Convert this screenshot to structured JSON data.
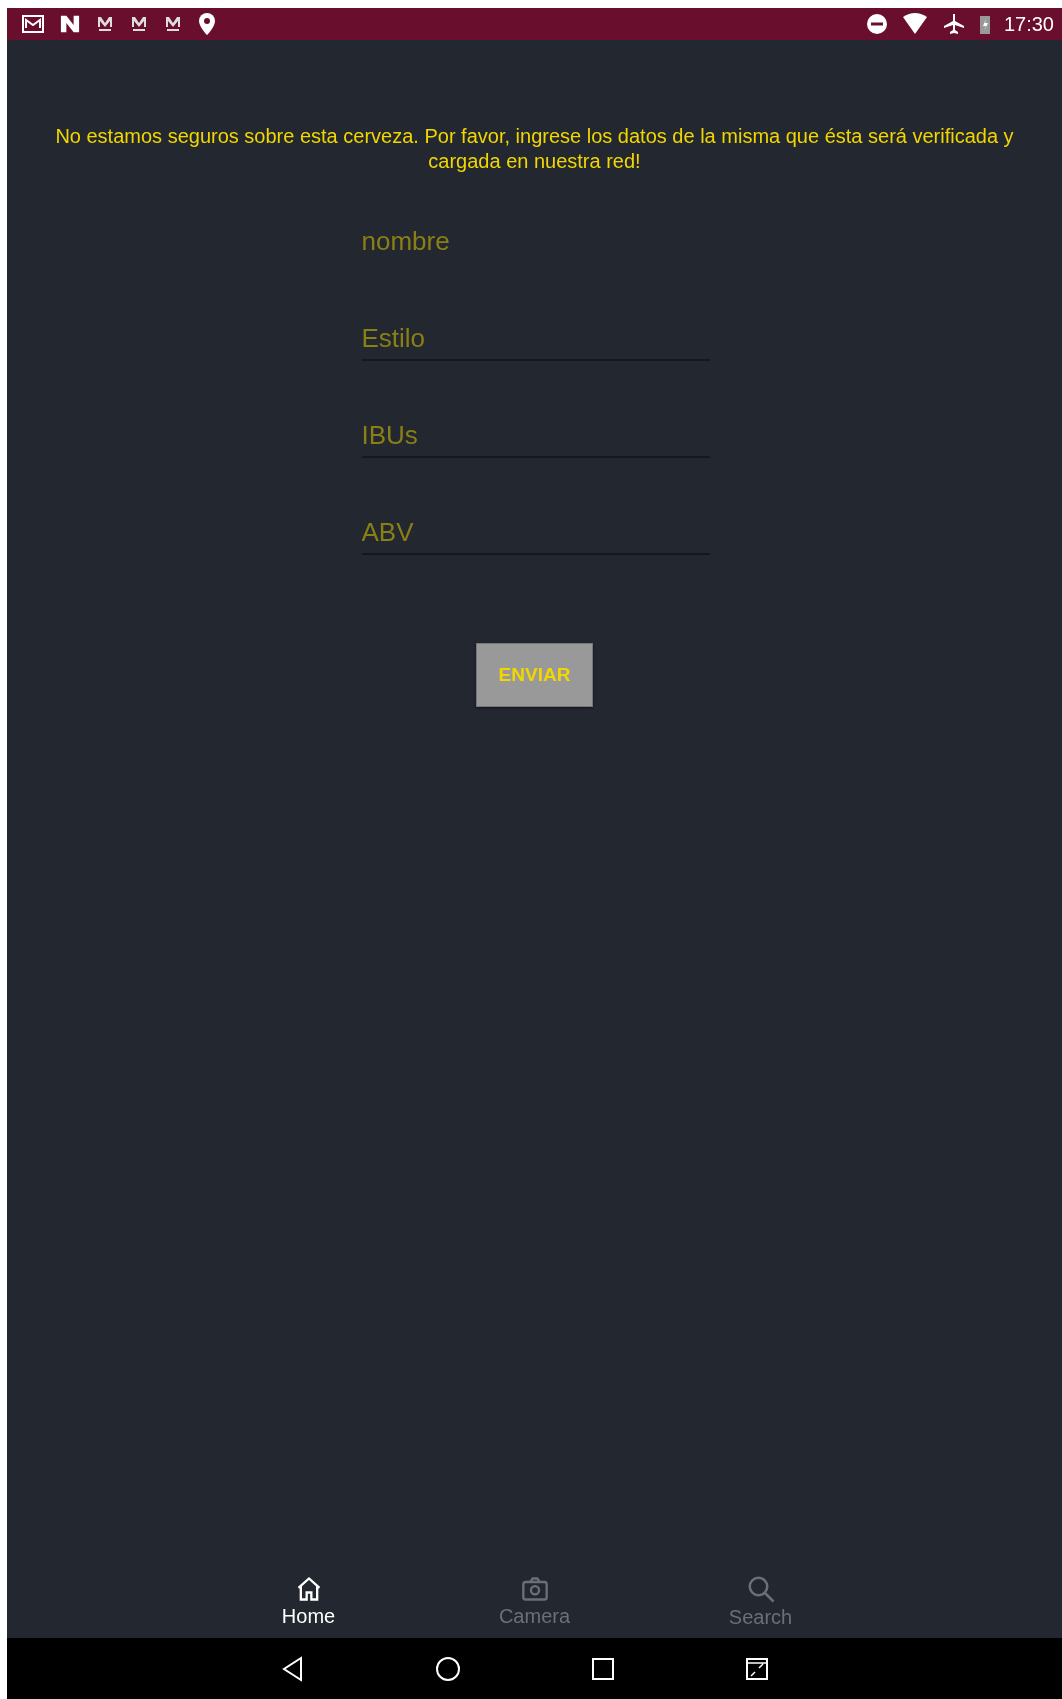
{
  "status_bar": {
    "time": "17:30"
  },
  "message": "No estamos seguros sobre esta cerveza. Por favor, ingrese los datos de la misma que ésta será verificada y cargada en nuestra red!",
  "fields": [
    {
      "placeholder": "nombre",
      "focused": true
    },
    {
      "placeholder": "Estilo",
      "focused": false
    },
    {
      "placeholder": "IBUs",
      "focused": false
    },
    {
      "placeholder": "ABV",
      "focused": false
    }
  ],
  "submit_button": "ENVIAR",
  "tabs": [
    {
      "label": "Home",
      "kind": "home",
      "selected": true
    },
    {
      "label": "Camera",
      "kind": "camera",
      "selected": false
    },
    {
      "label": "Search",
      "kind": "search",
      "selected": false
    }
  ]
}
